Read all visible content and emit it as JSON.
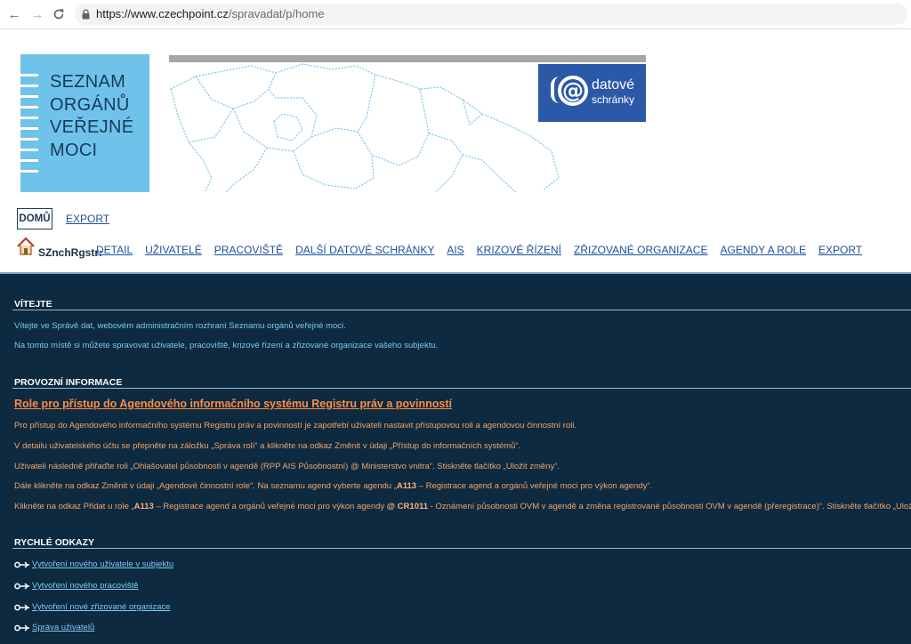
{
  "browser": {
    "url_host": "https://www.czechpoint.cz",
    "url_path": "/spravadat/p/home"
  },
  "header": {
    "logo_lines": [
      "SEZNAM",
      "ORGÁNŮ",
      "VEŘEJNÉ",
      "MOCI"
    ],
    "ds_logo_line1": "datové",
    "ds_logo_line2": "schránky"
  },
  "topnav": {
    "home": "DOMŮ",
    "export": "EXPORT"
  },
  "subnav": {
    "subject": "SZnchRgstr:",
    "tabs": [
      "DETAIL",
      "UŽIVATELÉ",
      "PRACOVIŠTĚ",
      "DALŠÍ DATOVÉ SCHRÁNKY",
      "AIS",
      "KRIZOVÉ ŘÍZENÍ",
      "ZŘIZOVANÉ ORGANIZACE",
      "AGENDY A ROLE",
      "EXPORT"
    ]
  },
  "welcome": {
    "heading": "VÍTEJTE",
    "line1": "Vítejte ve Správě dat, webovém administračním rozhraní Seznamu orgánů veřejné moci.",
    "line2": "Na tomto místě si můžete spravovat uživatele, pracoviště, krizové řízení a zřizované organizace vašeho subjektu."
  },
  "operational": {
    "heading": "PROVOZNÍ INFORMACE",
    "title": "Role pro přístup do Agendového informačního systému Registru práv a povinností",
    "p1": "Pro přístup do Agendového informačního systému Registru práv a povinností je zapotřebí uživateli nastavit přístupovou roli a agendovou činnostní roli.",
    "p2": "V detailu uživatelského účtu se přepněte na záložku „Správa rolí“ a klikněte na odkaz Změnit v údaji „Přístup do informačních systémů“.",
    "p3": "Uživateli následně přiřaďte roli „Ohlašovatel působnosti v agendě (RPP AIS Působnostní) @ Ministerstvo vnitra“. Stiskněte tlačítko „Uložit změny“.",
    "p4a": "Dále klikněte na odkaz Změnit v údaji „Agendové činnostní role“. Na seznamu agend vyberte agendu „",
    "p4b": "A113",
    "p4c": " – Registrace agend a orgánů veřejné moci pro výkon agendy“.",
    "p5a": "Klikněte na odkaz Přidat u role „",
    "p5b": "A113",
    "p5c": " – Registrace agend a orgánů veřejné moci pro výkon agendy ",
    "p5d": "@ CR1011",
    "p5e": " - Oznámení působnosti OVM v agendě a změna registrované působnosti OVM v agendě (přeregistrace)“. Stiskněte tlačítko „Uložit změny“."
  },
  "quicklinks": {
    "heading": "RYCHLÉ ODKAZY",
    "items": [
      "Vytvoření nového uživatele v subjektu",
      "Vytvoření nového pracoviště",
      "Vytvoření nové zřizované organizace",
      "Správa uživatelů"
    ]
  },
  "colors": {
    "panel_bg": "#0d2a40",
    "link_blue": "#1d4f9c",
    "text_cyan": "#7fc8f0",
    "text_orange": "#f2a36a",
    "logo_blue": "#6fc3ea",
    "ds_blue": "#2b58a7"
  }
}
